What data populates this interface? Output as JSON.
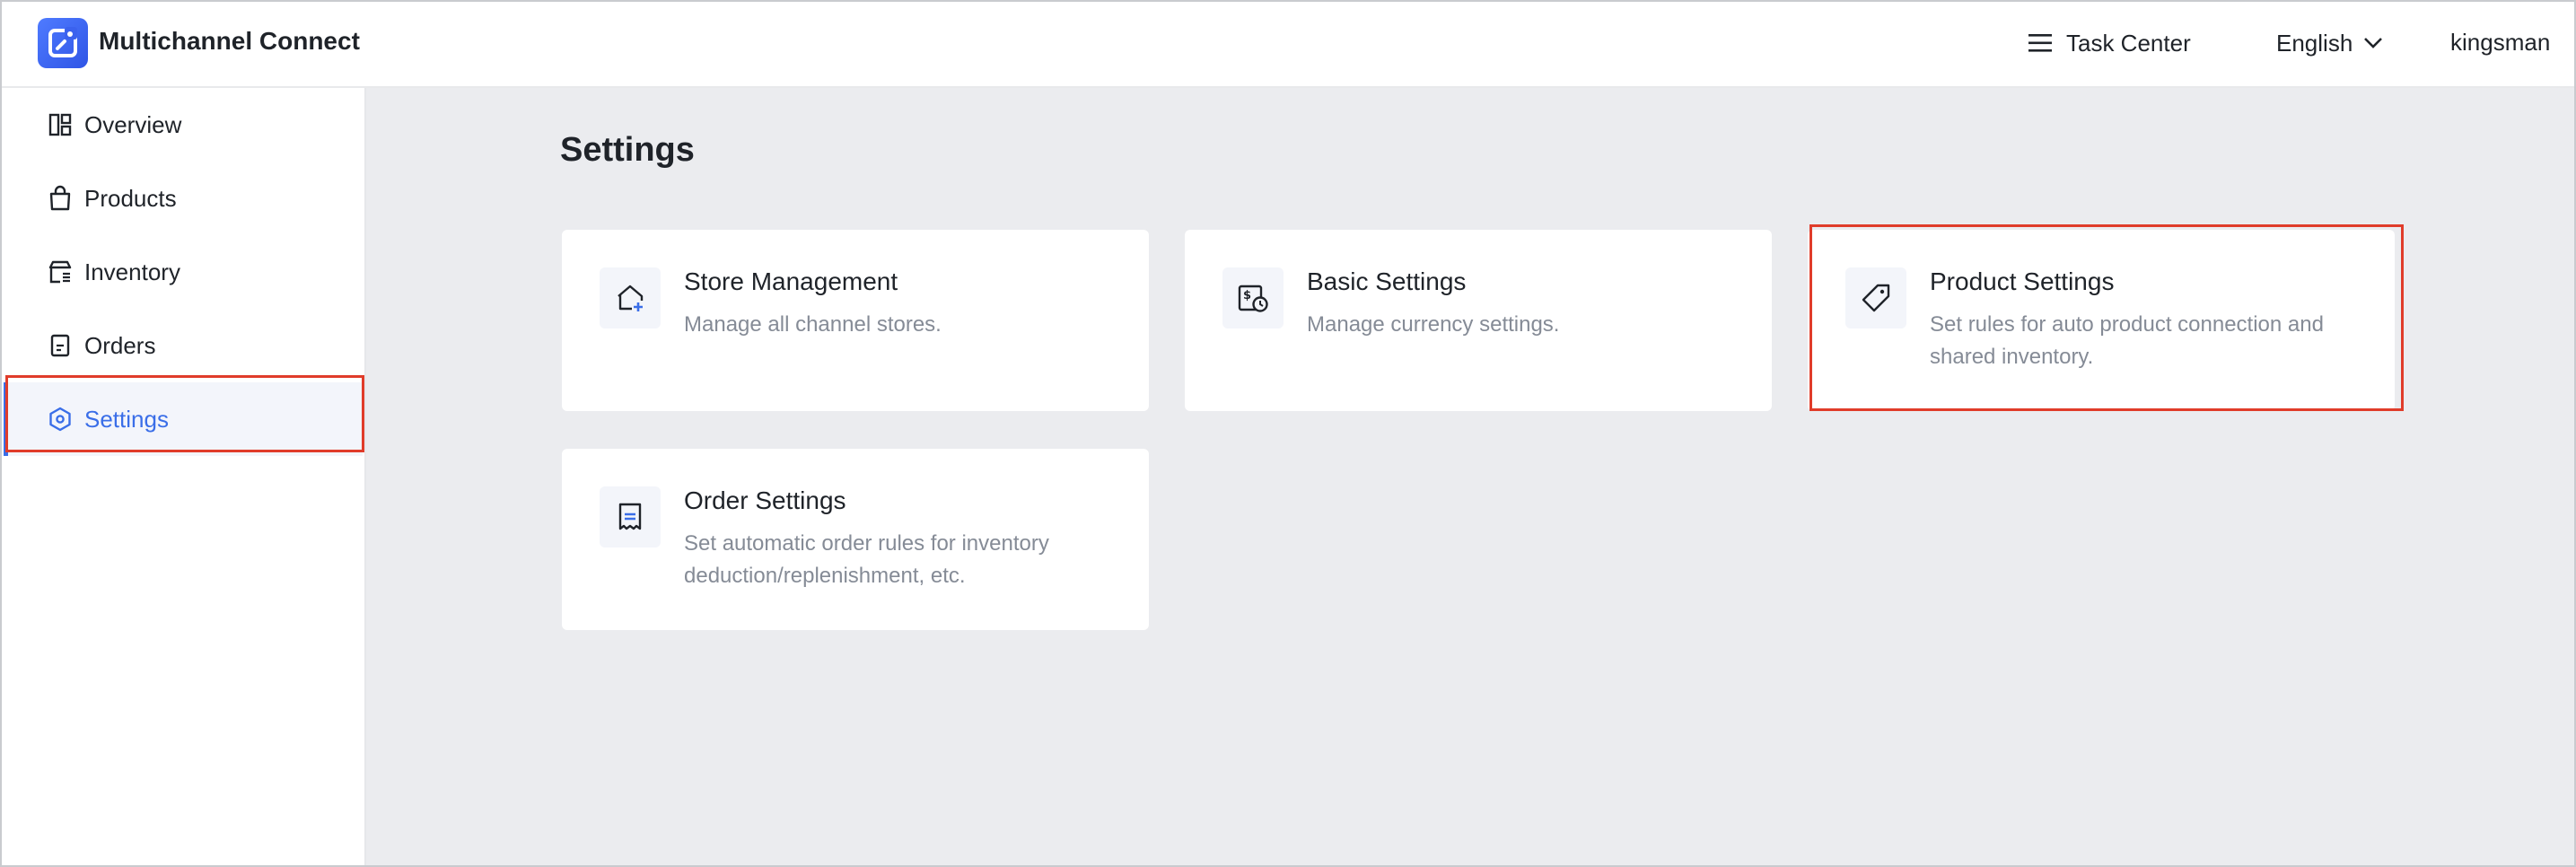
{
  "header": {
    "app_title": "Multichannel Connect",
    "task_center_label": "Task Center",
    "language_label": "English",
    "username": "kingsman"
  },
  "sidebar": {
    "items": [
      {
        "label": "Overview",
        "icon": "overview-icon"
      },
      {
        "label": "Products",
        "icon": "shopping-bag-icon"
      },
      {
        "label": "Inventory",
        "icon": "inventory-icon"
      },
      {
        "label": "Orders",
        "icon": "orders-icon"
      },
      {
        "label": "Settings",
        "icon": "settings-hexagon-icon",
        "active": true
      }
    ]
  },
  "main": {
    "page_title": "Settings",
    "cards": [
      {
        "title": "Store Management",
        "description": "Manage all channel stores.",
        "icon": "store-add-icon"
      },
      {
        "title": "Basic Settings",
        "description": "Manage currency settings.",
        "icon": "currency-icon"
      },
      {
        "title": "Product Settings",
        "description": "Set rules for auto product connection and shared inventory.",
        "icon": "tag-icon"
      },
      {
        "title": "Order Settings",
        "description": "Set automatic order rules for inventory deduction/replenishment, etc.",
        "icon": "order-document-icon"
      }
    ]
  },
  "colors": {
    "accent": "#3a6ee8",
    "highlight": "#e03c2a",
    "main_background": "#ebecef",
    "muted_text": "#858b96"
  }
}
